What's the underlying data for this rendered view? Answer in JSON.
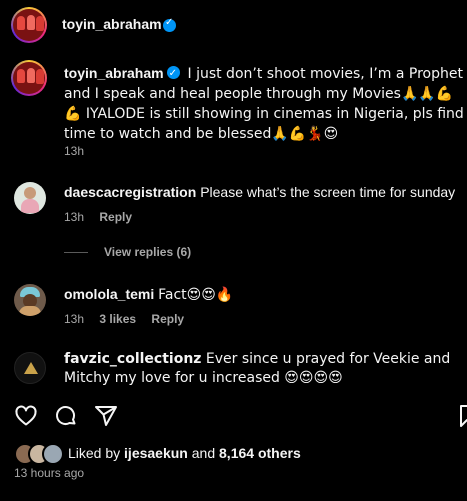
{
  "header": {
    "username": "toyin_abraham"
  },
  "caption": {
    "username": "toyin_abraham",
    "text": "I just don’t shoot movies, I’m a Prophet and I speak and heal people through my Movies🙏🙏💪💪 IYALODE is still showing in cinemas in Nigeria, pls find time to watch and be blessed🙏💪💃😍",
    "time": "13h"
  },
  "comments": [
    {
      "username": "daescacregistration",
      "text": "Please what’s the screen time for sunday",
      "time": "13h",
      "likes": "",
      "reply_label": "Reply",
      "view_replies": "View replies (6)"
    },
    {
      "username": "omololа_temi",
      "text": "Fact😍😍🔥",
      "time": "13h",
      "likes": "3 likes",
      "reply_label": "Reply"
    },
    {
      "username": "favzic_collectionz",
      "text": "Ever since u prayed for Veekie and Mitchy my love for u increased 😍😍😍😍"
    }
  ],
  "likes": {
    "prefix": "Liked by",
    "user": "ijesaekun",
    "middle": "and",
    "count": "8,164 others"
  },
  "post_time": "13 hours ago",
  "colors": {
    "background": "#000000",
    "text": "#f5f5f5",
    "secondary": "#a8a8a8",
    "verified": "#0095f6"
  }
}
